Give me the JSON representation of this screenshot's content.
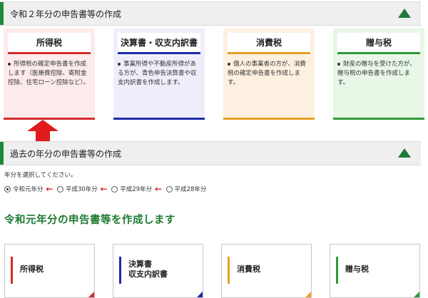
{
  "section_current": {
    "title": "令和２年分の申告書等の作成",
    "toggle_icon": "triangle-up-icon"
  },
  "cards": [
    {
      "label": "所得税",
      "desc": "所得税の確定申告書を作成します（医療費控除、寄附金控除、住宅ローン控除など）。",
      "color": "#d42b2b"
    },
    {
      "label": "決算書・収支内訳書",
      "desc": "事業所得や不動産所得がある方が、青色申告決算書や収支内訳書を作成します。",
      "color": "#1e2aa8"
    },
    {
      "label": "消費税",
      "desc": "個人の事業者の方が、消費税の確定申告書を作成します。",
      "color": "#e9a026"
    },
    {
      "label": "贈与税",
      "desc": "財産の贈与を受けた方が、贈与税の申告書を作成します。",
      "color": "#2f9a3a"
    }
  ],
  "annotation_arrow": "up-arrow-icon",
  "section_past": {
    "title": "過去の年分の申告書等の作成",
    "toggle_icon": "triangle-up-icon"
  },
  "year_select": {
    "prompt": "年分を選択してください。",
    "options": [
      "令和元年分",
      "平成30年分",
      "平成29年分",
      "平成28年分"
    ],
    "selected": "令和元年分",
    "arrow_glyph": "←"
  },
  "create_heading": "令和元年分の申告書等を作成します",
  "forms": [
    {
      "label": "所得税",
      "color": "#d42b2b"
    },
    {
      "label_line1": "決算書",
      "label_line2": "収支内訳書",
      "color": "#1e2aa8"
    },
    {
      "label": "消費税",
      "color": "#e9a026"
    },
    {
      "label": "贈与税",
      "color": "#2f9a3a"
    }
  ]
}
